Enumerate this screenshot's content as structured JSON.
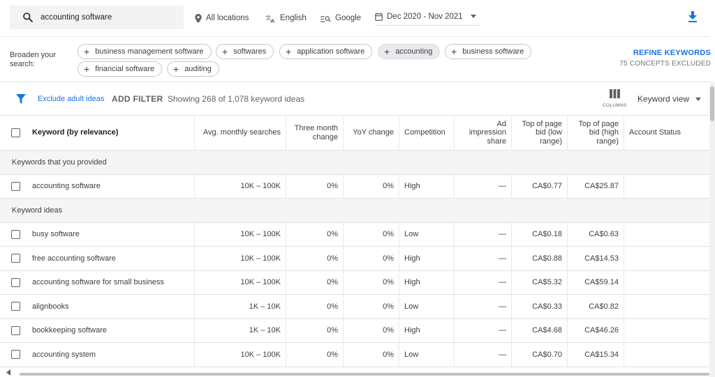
{
  "search": {
    "value": "accounting software"
  },
  "toolbar": {
    "location": "All locations",
    "language": "English",
    "network": "Google",
    "date_range": "Dec 2020 - Nov 2021"
  },
  "broaden": {
    "label": "Broaden your search:",
    "chips": [
      "business management software",
      "softwares",
      "application software",
      "accounting",
      "business software",
      "financial software",
      "auditing"
    ],
    "refine_label": "REFINE KEYWORDS",
    "excluded_label": "75 CONCEPTS EXCLUDED"
  },
  "filterbar": {
    "exclude_adult": "Exclude adult ideas",
    "add_filter": "ADD FILTER",
    "showing": "Showing 268 of 1,078 keyword ideas",
    "columns_label": "COLUMNS",
    "view_label": "Keyword view"
  },
  "table": {
    "headers": [
      "Keyword (by relevance)",
      "Avg. monthly searches",
      "Three month change",
      "YoY change",
      "Competition",
      "Ad impression share",
      "Top of page bid (low range)",
      "Top of page bid (high range)",
      "Account Status"
    ],
    "section_provided": "Keywords that you provided",
    "provided_rows": [
      [
        "accounting software",
        "10K – 100K",
        "0%",
        "0%",
        "High",
        "—",
        "CA$0.77",
        "CA$25.87",
        ""
      ]
    ],
    "section_ideas": "Keyword ideas",
    "idea_rows": [
      [
        "busy software",
        "10K – 100K",
        "0%",
        "0%",
        "Low",
        "—",
        "CA$0.18",
        "CA$0.63",
        ""
      ],
      [
        "free accounting software",
        "10K – 100K",
        "0%",
        "0%",
        "High",
        "—",
        "CA$0.88",
        "CA$14.53",
        ""
      ],
      [
        "accounting software for small business",
        "10K – 100K",
        "0%",
        "0%",
        "High",
        "—",
        "CA$5.32",
        "CA$59.14",
        ""
      ],
      [
        "alignbooks",
        "1K – 10K",
        "0%",
        "0%",
        "Low",
        "—",
        "CA$0.33",
        "CA$0.82",
        ""
      ],
      [
        "bookkeeping software",
        "1K – 10K",
        "0%",
        "0%",
        "High",
        "—",
        "CA$4.68",
        "CA$46.26",
        ""
      ],
      [
        "accounting system",
        "10K – 100K",
        "0%",
        "0%",
        "Low",
        "—",
        "CA$0.70",
        "CA$15.34",
        ""
      ]
    ]
  },
  "colors": {
    "accent": "#1a73e8",
    "text": "#3c4043",
    "section_bg": "#f5f5f5"
  }
}
